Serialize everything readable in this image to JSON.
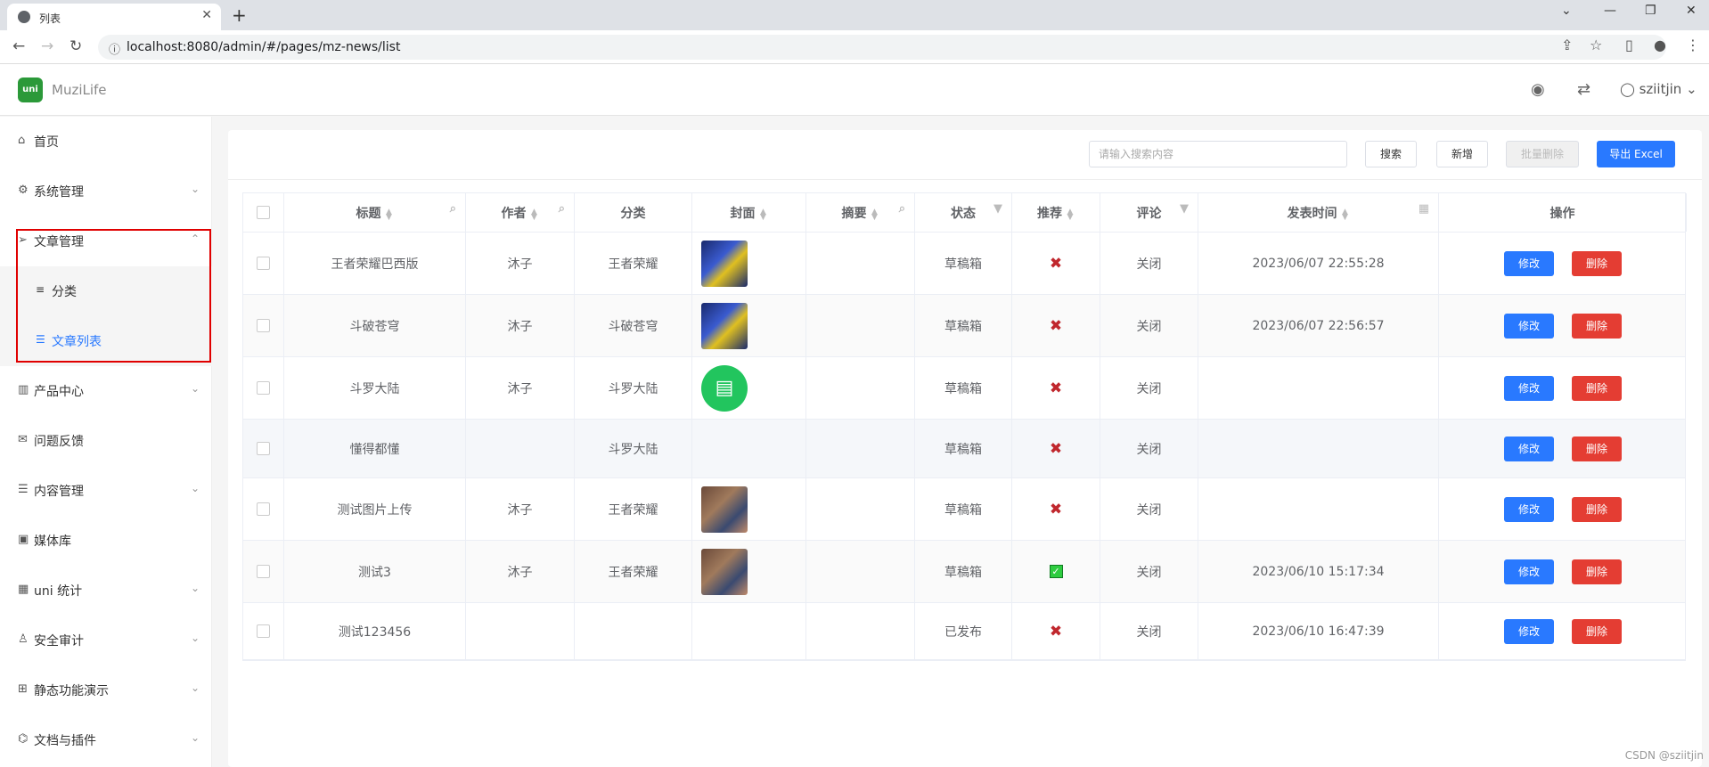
{
  "browser": {
    "tab_title": "列表",
    "url": "localhost:8080/admin/#/pages/mz-news/list"
  },
  "header": {
    "app_name": "MuziLife",
    "logo_text": "uni",
    "username": "sziitjin"
  },
  "sidebar": {
    "items": [
      {
        "label": "首页",
        "icon": "home-icon"
      },
      {
        "label": "系统管理",
        "icon": "gear-icon"
      },
      {
        "label": "文章管理",
        "icon": "send-icon"
      },
      {
        "label": "产品中心",
        "icon": "map-icon"
      },
      {
        "label": "问题反馈",
        "icon": "chat-icon"
      },
      {
        "label": "内容管理",
        "icon": "list-icon"
      },
      {
        "label": "媒体库",
        "icon": "image-icon"
      },
      {
        "label": "uni 统计",
        "icon": "chart-icon"
      },
      {
        "label": "安全审计",
        "icon": "person-icon"
      },
      {
        "label": "静态功能演示",
        "icon": "grid-icon"
      },
      {
        "label": "文档与插件",
        "icon": "plugin-icon"
      }
    ],
    "submenu": [
      {
        "label": "分类",
        "icon": "menu-icon"
      },
      {
        "label": "文章列表",
        "icon": "list-icon"
      }
    ]
  },
  "toolbar": {
    "search_placeholder": "请输入搜索内容",
    "search_button": "搜索",
    "add_button": "新增",
    "batch_delete_button": "批量删除",
    "export_button": "导出 Excel"
  },
  "table": {
    "columns": [
      "标题",
      "作者",
      "分类",
      "封面",
      "摘要",
      "状态",
      "推荐",
      "评论",
      "发表时间",
      "操作"
    ],
    "rows": [
      {
        "title": "王者荣耀巴西版",
        "author": "沐子",
        "category": "王者荣耀",
        "cover": "game",
        "summary": "",
        "status": "草稿箱",
        "recommend": false,
        "comment": "关闭",
        "time": "2023/06/07 22:55:28"
      },
      {
        "title": "斗破苍穹",
        "author": "沐子",
        "category": "斗破苍穹",
        "cover": "game",
        "summary": "",
        "status": "草稿箱",
        "recommend": false,
        "comment": "关闭",
        "time": "2023/06/07 22:56:57"
      },
      {
        "title": "斗罗大陆",
        "author": "沐子",
        "category": "斗罗大陆",
        "cover": "app",
        "summary": "",
        "status": "草稿箱",
        "recommend": false,
        "comment": "关闭",
        "time": ""
      },
      {
        "title": "懂得都懂",
        "author": "",
        "category": "斗罗大陆",
        "cover": "",
        "summary": "",
        "status": "草稿箱",
        "recommend": false,
        "comment": "关闭",
        "time": ""
      },
      {
        "title": "测试图片上传",
        "author": "沐子",
        "category": "王者荣耀",
        "cover": "art",
        "summary": "",
        "status": "草稿箱",
        "recommend": false,
        "comment": "关闭",
        "time": ""
      },
      {
        "title": "测试3",
        "author": "沐子",
        "category": "王者荣耀",
        "cover": "art",
        "summary": "",
        "status": "草稿箱",
        "recommend": true,
        "comment": "关闭",
        "time": "2023/06/10 15:17:34"
      },
      {
        "title": "测试123456",
        "author": "",
        "category": "",
        "cover": "",
        "summary": "",
        "status": "已发布",
        "recommend": false,
        "comment": "关闭",
        "time": "2023/06/10 16:47:39"
      }
    ],
    "edit_label": "修改",
    "delete_label": "删除"
  },
  "watermark": "CSDN @sziitjin",
  "colors": {
    "primary": "#2979ff",
    "danger": "#e43d33",
    "highlight_box": "#e00000",
    "active_menu": "#2979ff"
  }
}
